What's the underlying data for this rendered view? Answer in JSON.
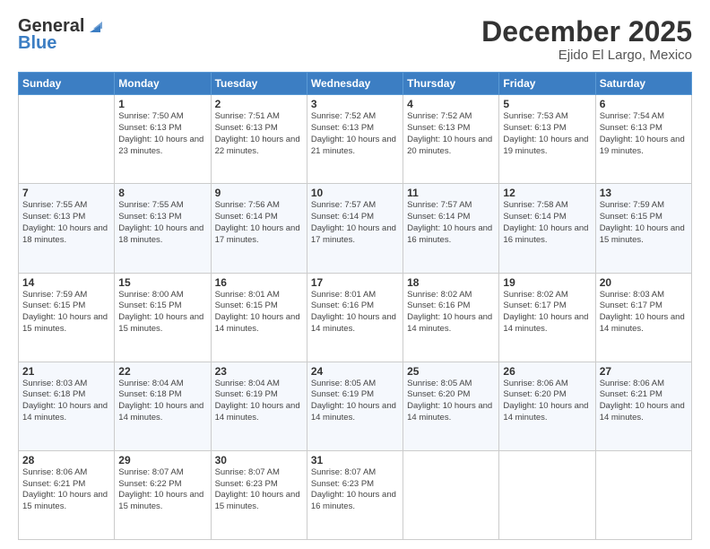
{
  "header": {
    "logo_general": "General",
    "logo_blue": "Blue",
    "month": "December 2025",
    "location": "Ejido El Largo, Mexico"
  },
  "days_of_week": [
    "Sunday",
    "Monday",
    "Tuesday",
    "Wednesday",
    "Thursday",
    "Friday",
    "Saturday"
  ],
  "weeks": [
    [
      {
        "day": "",
        "sunrise": "",
        "sunset": "",
        "daylight": ""
      },
      {
        "day": "1",
        "sunrise": "Sunrise: 7:50 AM",
        "sunset": "Sunset: 6:13 PM",
        "daylight": "Daylight: 10 hours and 23 minutes."
      },
      {
        "day": "2",
        "sunrise": "Sunrise: 7:51 AM",
        "sunset": "Sunset: 6:13 PM",
        "daylight": "Daylight: 10 hours and 22 minutes."
      },
      {
        "day": "3",
        "sunrise": "Sunrise: 7:52 AM",
        "sunset": "Sunset: 6:13 PM",
        "daylight": "Daylight: 10 hours and 21 minutes."
      },
      {
        "day": "4",
        "sunrise": "Sunrise: 7:52 AM",
        "sunset": "Sunset: 6:13 PM",
        "daylight": "Daylight: 10 hours and 20 minutes."
      },
      {
        "day": "5",
        "sunrise": "Sunrise: 7:53 AM",
        "sunset": "Sunset: 6:13 PM",
        "daylight": "Daylight: 10 hours and 19 minutes."
      },
      {
        "day": "6",
        "sunrise": "Sunrise: 7:54 AM",
        "sunset": "Sunset: 6:13 PM",
        "daylight": "Daylight: 10 hours and 19 minutes."
      }
    ],
    [
      {
        "day": "7",
        "sunrise": "Sunrise: 7:55 AM",
        "sunset": "Sunset: 6:13 PM",
        "daylight": "Daylight: 10 hours and 18 minutes."
      },
      {
        "day": "8",
        "sunrise": "Sunrise: 7:55 AM",
        "sunset": "Sunset: 6:13 PM",
        "daylight": "Daylight: 10 hours and 18 minutes."
      },
      {
        "day": "9",
        "sunrise": "Sunrise: 7:56 AM",
        "sunset": "Sunset: 6:14 PM",
        "daylight": "Daylight: 10 hours and 17 minutes."
      },
      {
        "day": "10",
        "sunrise": "Sunrise: 7:57 AM",
        "sunset": "Sunset: 6:14 PM",
        "daylight": "Daylight: 10 hours and 17 minutes."
      },
      {
        "day": "11",
        "sunrise": "Sunrise: 7:57 AM",
        "sunset": "Sunset: 6:14 PM",
        "daylight": "Daylight: 10 hours and 16 minutes."
      },
      {
        "day": "12",
        "sunrise": "Sunrise: 7:58 AM",
        "sunset": "Sunset: 6:14 PM",
        "daylight": "Daylight: 10 hours and 16 minutes."
      },
      {
        "day": "13",
        "sunrise": "Sunrise: 7:59 AM",
        "sunset": "Sunset: 6:15 PM",
        "daylight": "Daylight: 10 hours and 15 minutes."
      }
    ],
    [
      {
        "day": "14",
        "sunrise": "Sunrise: 7:59 AM",
        "sunset": "Sunset: 6:15 PM",
        "daylight": "Daylight: 10 hours and 15 minutes."
      },
      {
        "day": "15",
        "sunrise": "Sunrise: 8:00 AM",
        "sunset": "Sunset: 6:15 PM",
        "daylight": "Daylight: 10 hours and 15 minutes."
      },
      {
        "day": "16",
        "sunrise": "Sunrise: 8:01 AM",
        "sunset": "Sunset: 6:15 PM",
        "daylight": "Daylight: 10 hours and 14 minutes."
      },
      {
        "day": "17",
        "sunrise": "Sunrise: 8:01 AM",
        "sunset": "Sunset: 6:16 PM",
        "daylight": "Daylight: 10 hours and 14 minutes."
      },
      {
        "day": "18",
        "sunrise": "Sunrise: 8:02 AM",
        "sunset": "Sunset: 6:16 PM",
        "daylight": "Daylight: 10 hours and 14 minutes."
      },
      {
        "day": "19",
        "sunrise": "Sunrise: 8:02 AM",
        "sunset": "Sunset: 6:17 PM",
        "daylight": "Daylight: 10 hours and 14 minutes."
      },
      {
        "day": "20",
        "sunrise": "Sunrise: 8:03 AM",
        "sunset": "Sunset: 6:17 PM",
        "daylight": "Daylight: 10 hours and 14 minutes."
      }
    ],
    [
      {
        "day": "21",
        "sunrise": "Sunrise: 8:03 AM",
        "sunset": "Sunset: 6:18 PM",
        "daylight": "Daylight: 10 hours and 14 minutes."
      },
      {
        "day": "22",
        "sunrise": "Sunrise: 8:04 AM",
        "sunset": "Sunset: 6:18 PM",
        "daylight": "Daylight: 10 hours and 14 minutes."
      },
      {
        "day": "23",
        "sunrise": "Sunrise: 8:04 AM",
        "sunset": "Sunset: 6:19 PM",
        "daylight": "Daylight: 10 hours and 14 minutes."
      },
      {
        "day": "24",
        "sunrise": "Sunrise: 8:05 AM",
        "sunset": "Sunset: 6:19 PM",
        "daylight": "Daylight: 10 hours and 14 minutes."
      },
      {
        "day": "25",
        "sunrise": "Sunrise: 8:05 AM",
        "sunset": "Sunset: 6:20 PM",
        "daylight": "Daylight: 10 hours and 14 minutes."
      },
      {
        "day": "26",
        "sunrise": "Sunrise: 8:06 AM",
        "sunset": "Sunset: 6:20 PM",
        "daylight": "Daylight: 10 hours and 14 minutes."
      },
      {
        "day": "27",
        "sunrise": "Sunrise: 8:06 AM",
        "sunset": "Sunset: 6:21 PM",
        "daylight": "Daylight: 10 hours and 14 minutes."
      }
    ],
    [
      {
        "day": "28",
        "sunrise": "Sunrise: 8:06 AM",
        "sunset": "Sunset: 6:21 PM",
        "daylight": "Daylight: 10 hours and 15 minutes."
      },
      {
        "day": "29",
        "sunrise": "Sunrise: 8:07 AM",
        "sunset": "Sunset: 6:22 PM",
        "daylight": "Daylight: 10 hours and 15 minutes."
      },
      {
        "day": "30",
        "sunrise": "Sunrise: 8:07 AM",
        "sunset": "Sunset: 6:23 PM",
        "daylight": "Daylight: 10 hours and 15 minutes."
      },
      {
        "day": "31",
        "sunrise": "Sunrise: 8:07 AM",
        "sunset": "Sunset: 6:23 PM",
        "daylight": "Daylight: 10 hours and 16 minutes."
      },
      {
        "day": "",
        "sunrise": "",
        "sunset": "",
        "daylight": ""
      },
      {
        "day": "",
        "sunrise": "",
        "sunset": "",
        "daylight": ""
      },
      {
        "day": "",
        "sunrise": "",
        "sunset": "",
        "daylight": ""
      }
    ]
  ]
}
